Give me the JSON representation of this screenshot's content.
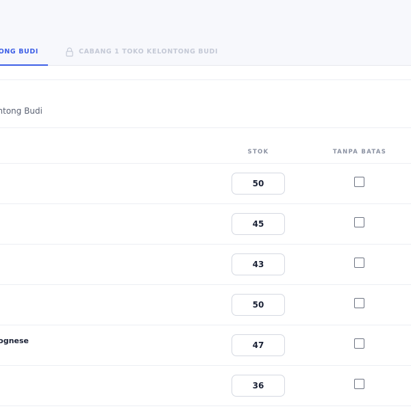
{
  "tabs": [
    {
      "label": "ONG BUDI",
      "active": true
    },
    {
      "label": "CABANG 1 TOKO KELONTONG BUDI",
      "locked": true,
      "icon": "lock-icon"
    }
  ],
  "store_line": "elontong Budi",
  "table": {
    "columns": {
      "stok": "STOK",
      "tanpa_batas": "TANPA BATAS"
    },
    "rows": [
      {
        "name": "",
        "stok": "50",
        "tanpa_batas": false
      },
      {
        "name": "",
        "stok": "45",
        "tanpa_batas": false
      },
      {
        "name": "",
        "stok": "43",
        "tanpa_batas": false
      },
      {
        "name": "",
        "stok": "50",
        "tanpa_batas": false
      },
      {
        "name": "olognese",
        "stok": "47",
        "tanpa_batas": false
      },
      {
        "name": "",
        "stok": "36",
        "tanpa_batas": false
      }
    ]
  },
  "colors": {
    "accent": "#3c5ee6",
    "muted": "#c4c9d6"
  }
}
